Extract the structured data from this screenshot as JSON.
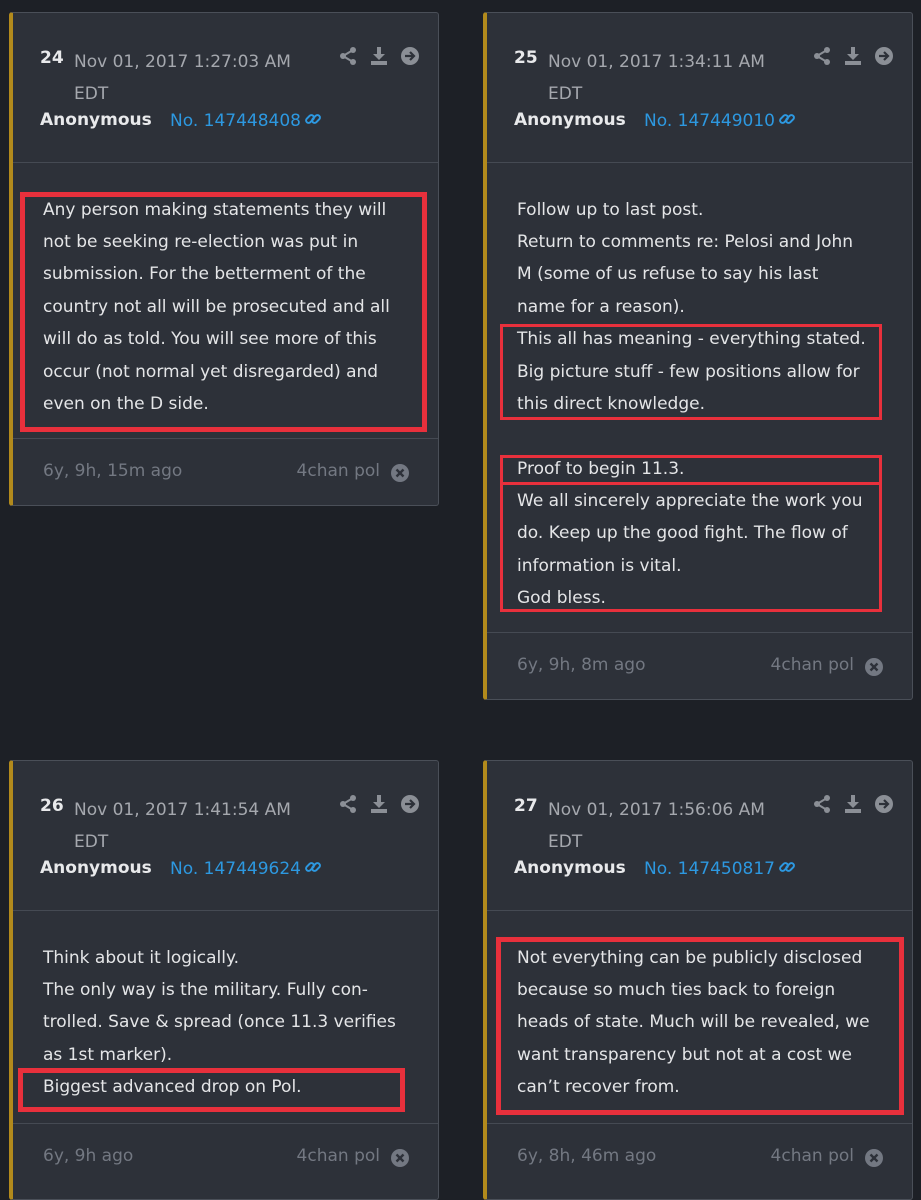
{
  "posts": [
    {
      "number": "24",
      "date": "Nov 01, 2017 1:27:03 AM EDT",
      "author": "Anonymous",
      "post_id": "No. 147448408",
      "lines": [
        "Any person making statements they will",
        "not be seeking re-election was put in",
        "submission. For the betterment of the",
        "country not all will be prosecuted and all",
        "will do as told. You will see more of this",
        "occur (not normal yet disregarded) and",
        "even on the D side."
      ],
      "ago": "6y, 9h, 15m ago",
      "source": "4chan pol"
    },
    {
      "number": "25",
      "date": "Nov 01, 2017 1:34:11 AM EDT",
      "author": "Anonymous",
      "post_id": "No. 147449010",
      "lines": [
        "Follow up to last post.",
        "Return to comments re: Pelosi and John",
        "M (some of us refuse to say his last",
        "name for a reason).",
        "This all has meaning - everything stated.",
        "Big picture stuff - few positions allow for",
        "this direct knowledge.",
        "Proof to begin 11.3.",
        "We all sincerely appreciate the work you",
        "do. Keep up the good fight. The flow of",
        "information is vital.",
        "God bless."
      ],
      "ago": "6y, 9h, 8m ago",
      "source": "4chan pol"
    },
    {
      "number": "26",
      "date": "Nov 01, 2017 1:41:54 AM EDT",
      "author": "Anonymous",
      "post_id": "No. 147449624",
      "lines": [
        "Think about it logically.",
        "The only way is the military. Fully con-",
        "trolled. Save & spread (once 11.3 verifies",
        "as 1st marker).",
        "Biggest advanced drop on Pol."
      ],
      "ago": "6y, 9h ago",
      "source": "4chan pol"
    },
    {
      "number": "27",
      "date": "Nov 01, 2017 1:56:06 AM EDT",
      "author": "Anonymous",
      "post_id": "No. 147450817",
      "lines": [
        "Not everything can be publicly disclosed",
        "because so much ties back to foreign",
        "heads of state. Much will be revealed, we",
        "want transparency but not at a cost we",
        "can’t recover from."
      ],
      "ago": "6y, 8h, 46m ago",
      "source": "4chan pol"
    }
  ],
  "colors": {
    "background": "#1d2026",
    "card": "#2d3139",
    "accent_bar": "#b28a1c",
    "link": "#2d98e0",
    "highlight": "#e8303c"
  },
  "icons": [
    "share-icon",
    "download-icon",
    "arrow-right-circle-icon",
    "link-icon",
    "close-circle-icon"
  ]
}
